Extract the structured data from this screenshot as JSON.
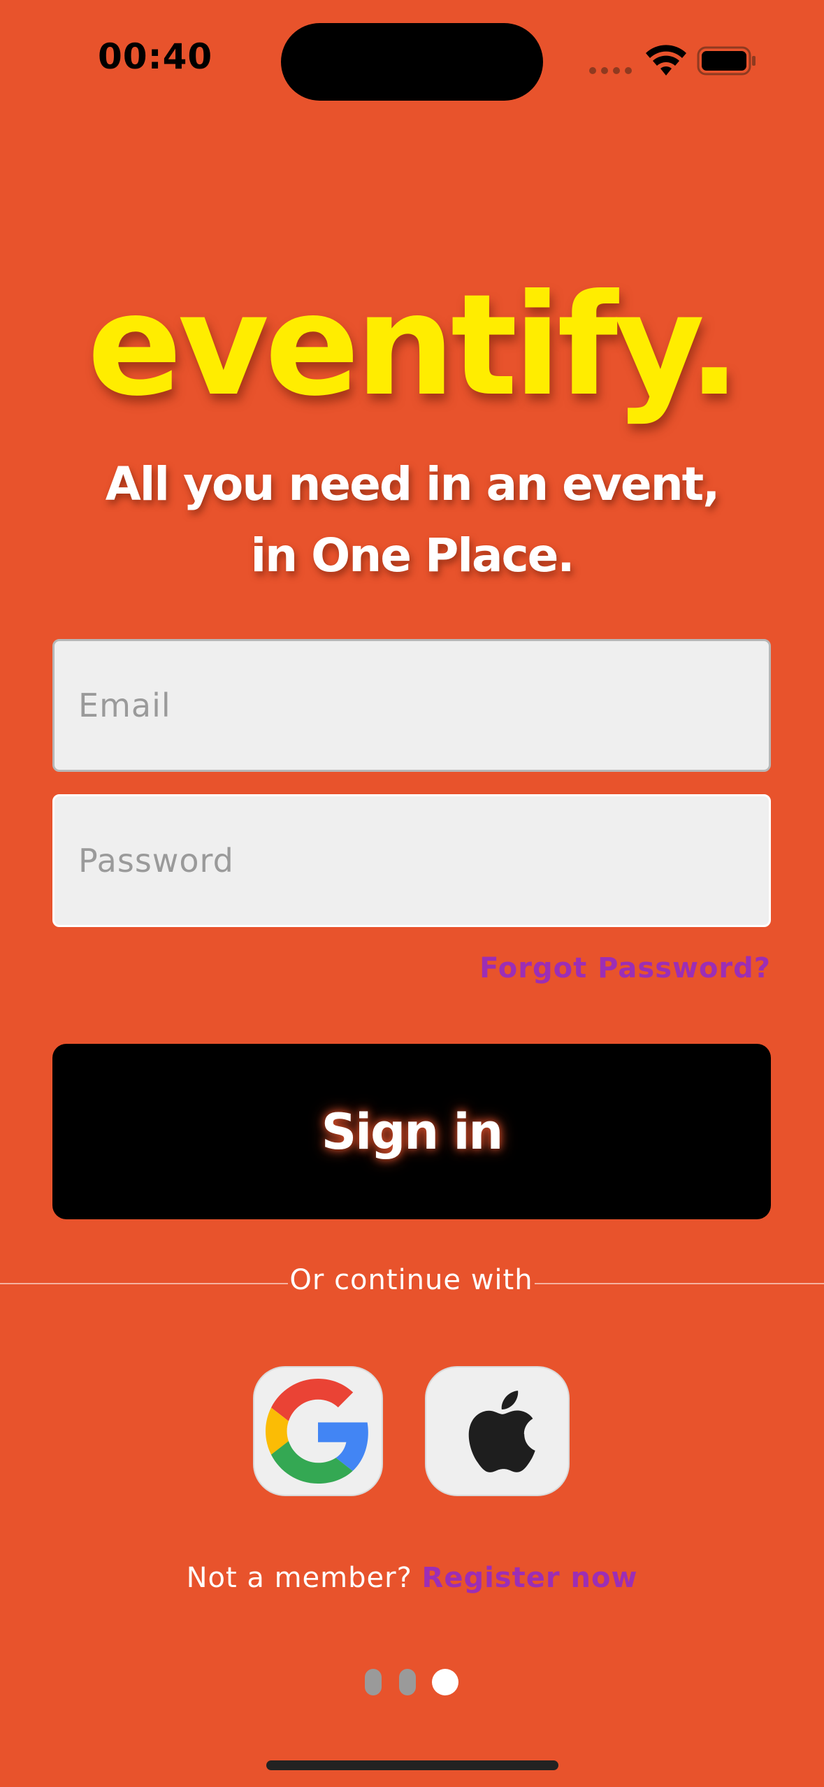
{
  "status_bar": {
    "time": "00:40",
    "signal_icon": "cellular-signal-icon",
    "wifi_icon": "wifi-icon",
    "battery_icon": "battery-icon"
  },
  "brand": {
    "logo": "eventify.",
    "tagline_line1": "All you need in an event,",
    "tagline_line2": "in One Place."
  },
  "form": {
    "email_placeholder": "Email",
    "email_value": "",
    "password_placeholder": "Password",
    "password_value": "",
    "forgot_password": "Forgot Password?",
    "sign_in": "Sign in"
  },
  "social": {
    "divider_text": "Or continue with",
    "providers": [
      {
        "name": "google",
        "icon": "google-logo-icon"
      },
      {
        "name": "apple",
        "icon": "apple-logo-icon"
      }
    ]
  },
  "register": {
    "prompt": "Not a member?",
    "link": "Register now"
  },
  "pagination": {
    "total": 3,
    "active_index": 2
  },
  "colors": {
    "background": "#E8532C",
    "logo": "#FFED00",
    "link": "#9C2EB5",
    "button": "#000000"
  }
}
